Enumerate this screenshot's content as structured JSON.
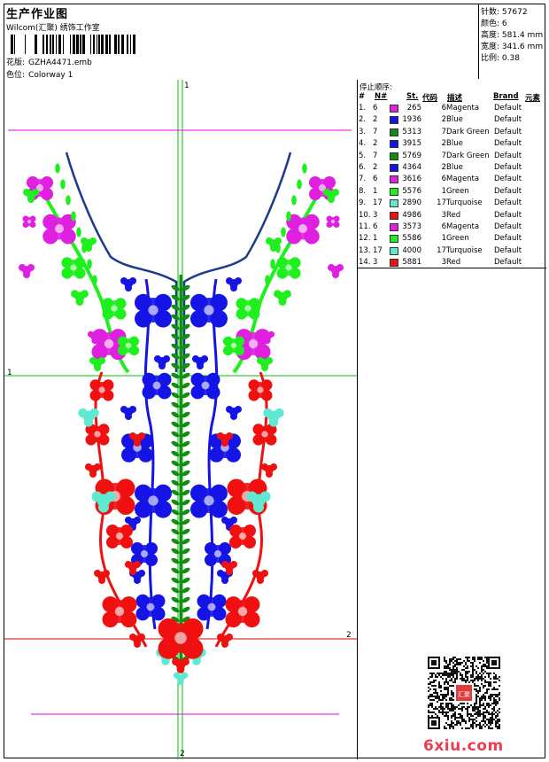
{
  "header": {
    "title": "生产作业图",
    "company": "Wilcom(汇聚) 绣饰工作室",
    "design_label": "花版:",
    "design_value": "GZHA4471.emb",
    "colorway_label": "色位:",
    "colorway_value": "Colorway 1",
    "stats": [
      {
        "label": "针数:",
        "value": "57672"
      },
      {
        "label": "颜色:",
        "value": "6"
      },
      {
        "label": "高度:",
        "value": "581.4 mm"
      },
      {
        "label": "宽度:",
        "value": "341.6 mm"
      },
      {
        "label": "比例:",
        "value": "0.38"
      }
    ]
  },
  "canvas": {
    "guide_labels": {
      "top": "1",
      "left": "1",
      "right": "2",
      "bottom": "2"
    },
    "colors": {
      "green_guides": "#00c000",
      "magenta_guides": "#e600e6",
      "red_guides": "#e00000",
      "green_thread": "#1ef01e",
      "blue_thread": "#1414e6",
      "red_thread": "#f01010",
      "magenta_thread": "#e020e0",
      "dark_green_thread": "#138c13",
      "turquoise_thread": "#5fe8d2"
    }
  },
  "stop_sequence": {
    "title": "停止顺序:",
    "headers": {
      "num": "#",
      "needle": "N#",
      "stitches": "St.",
      "code": "代码",
      "description": "描述",
      "brand": "Brand",
      "element": "元素"
    },
    "rows": [
      {
        "num": "1.",
        "needle": "6",
        "color": "#e020e0",
        "stitches": "265",
        "code": "6",
        "desc": "Magenta",
        "brand": "Default"
      },
      {
        "num": "2.",
        "needle": "2",
        "color": "#1414e6",
        "stitches": "1936",
        "code": "2",
        "desc": "Blue",
        "brand": "Default"
      },
      {
        "num": "3.",
        "needle": "7",
        "color": "#138c13",
        "stitches": "5313",
        "code": "7",
        "desc": "Dark Green",
        "brand": "Default"
      },
      {
        "num": "4.",
        "needle": "2",
        "color": "#1414e6",
        "stitches": "3915",
        "code": "2",
        "desc": "Blue",
        "brand": "Default"
      },
      {
        "num": "5.",
        "needle": "7",
        "color": "#138c13",
        "stitches": "5769",
        "code": "7",
        "desc": "Dark Green",
        "brand": "Default"
      },
      {
        "num": "6.",
        "needle": "2",
        "color": "#1414e6",
        "stitches": "4364",
        "code": "2",
        "desc": "Blue",
        "brand": "Default"
      },
      {
        "num": "7.",
        "needle": "6",
        "color": "#e020e0",
        "stitches": "3616",
        "code": "6",
        "desc": "Magenta",
        "brand": "Default"
      },
      {
        "num": "8.",
        "needle": "1",
        "color": "#1ef01e",
        "stitches": "5576",
        "code": "1",
        "desc": "Green",
        "brand": "Default"
      },
      {
        "num": "9.",
        "needle": "17",
        "color": "#5fe8d2",
        "stitches": "2890",
        "code": "17",
        "desc": "Turquoise",
        "brand": "Default"
      },
      {
        "num": "10.",
        "needle": "3",
        "color": "#f01010",
        "stitches": "4986",
        "code": "3",
        "desc": "Red",
        "brand": "Default"
      },
      {
        "num": "11.",
        "needle": "6",
        "color": "#e020e0",
        "stitches": "3573",
        "code": "6",
        "desc": "Magenta",
        "brand": "Default"
      },
      {
        "num": "12.",
        "needle": "1",
        "color": "#1ef01e",
        "stitches": "5586",
        "code": "1",
        "desc": "Green",
        "brand": "Default"
      },
      {
        "num": "13.",
        "needle": "17",
        "color": "#5fe8d2",
        "stitches": "4000",
        "code": "17",
        "desc": "Turquoise",
        "brand": "Default"
      },
      {
        "num": "14.",
        "needle": "3",
        "color": "#f01010",
        "stitches": "5881",
        "code": "3",
        "desc": "Red",
        "brand": "Default"
      }
    ]
  },
  "watermark": "6xiu.com",
  "qr_badge": "汇聚"
}
